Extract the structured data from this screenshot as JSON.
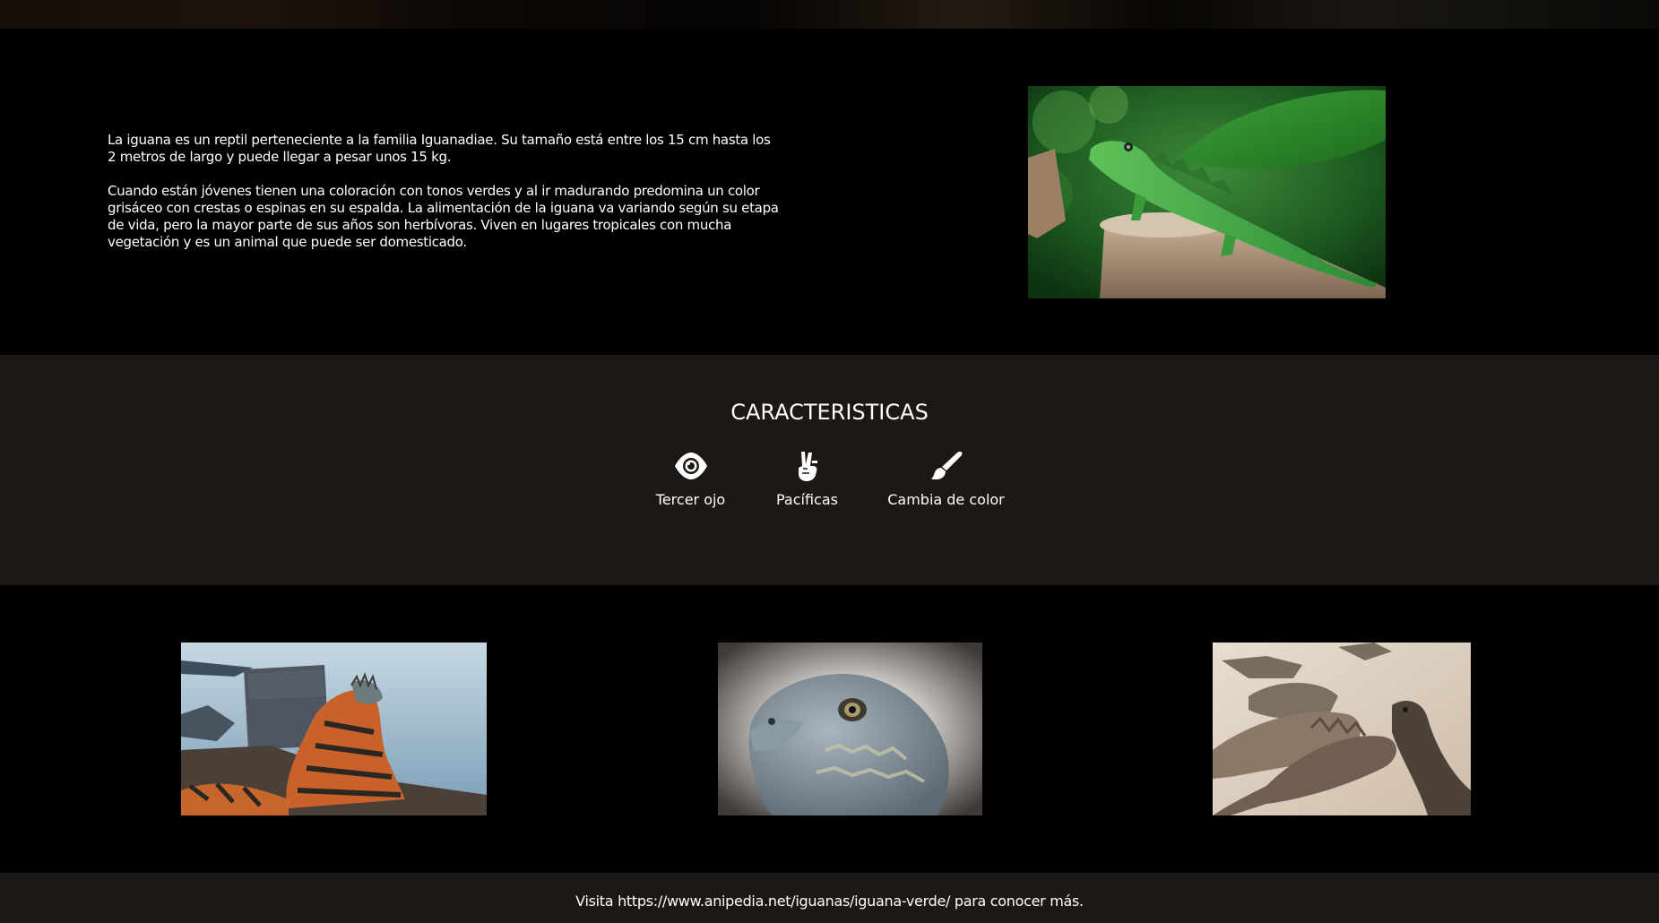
{
  "intro": {
    "paragraph1": "La iguana es un reptil perteneciente a la familia Iguanadiae. Su tamaño está entre los 15 cm hasta los 2 metros de largo y puede llegar a pesar unos 15 kg.",
    "paragraph2": "Cuando están jóvenes tienen una coloración con tonos verdes y al ir madurando predomina un color grisáceo con crestas o espinas en su espalda. La alimentación de la iguana va variando según su etapa de vida, pero la mayor parte de sus años son herbívoras. Viven en lugares tropicales con mucha vegetación y es un animal que puede ser domesticado."
  },
  "features": {
    "title": "CARACTERISTICAS",
    "items": [
      {
        "label": "Tercer ojo",
        "icon": "eye-icon"
      },
      {
        "label": "Pacíficas",
        "icon": "peace-hand-icon"
      },
      {
        "label": "Cambia de color",
        "icon": "paint-brush-icon"
      }
    ]
  },
  "footer": {
    "prefix": "Visita ",
    "link": "https://www.anipedia.net/iguanas/iguana-verde/",
    "suffix": " para conocer más."
  },
  "colors": {
    "background": "#000000",
    "section_alt": "#1b1815",
    "text": "#ffffff"
  }
}
